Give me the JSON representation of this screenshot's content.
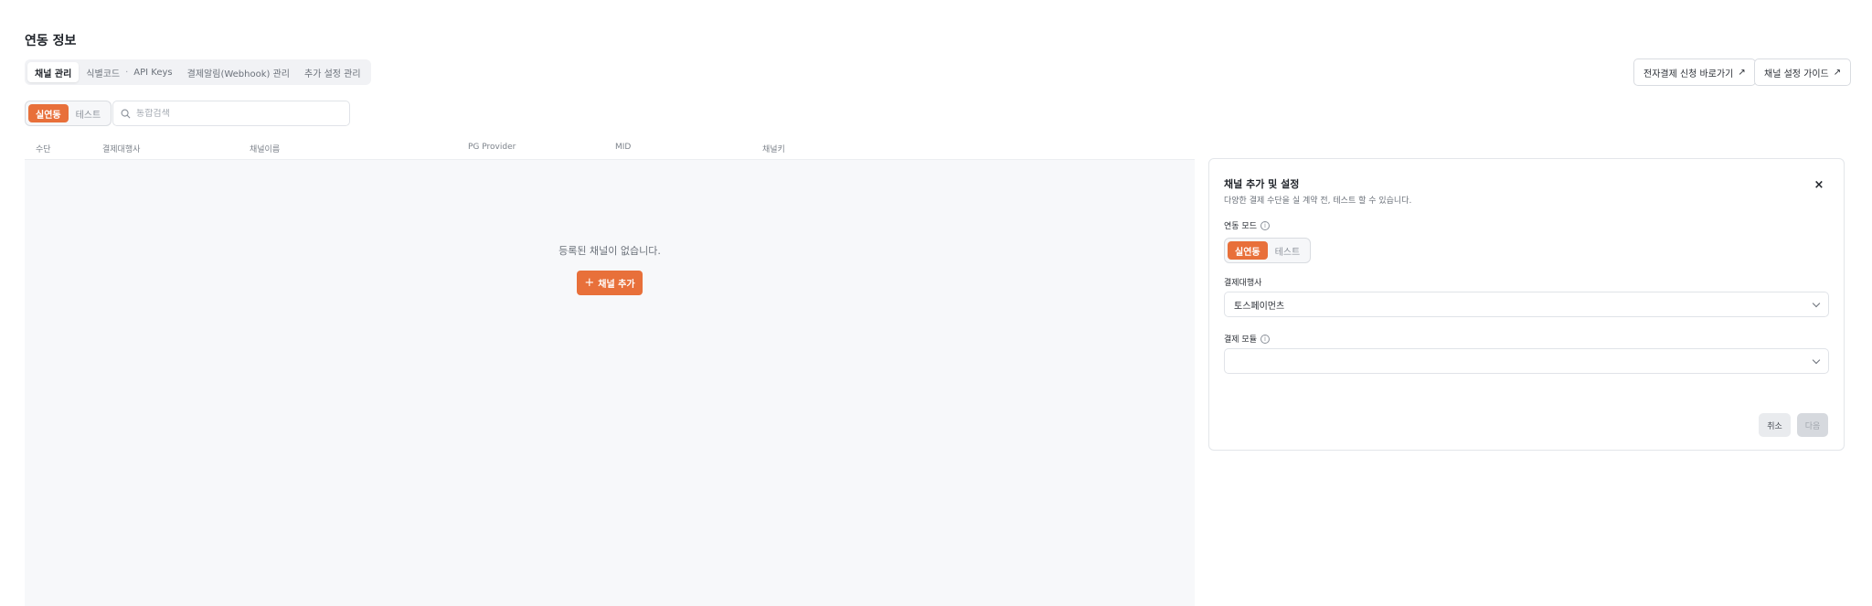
{
  "page_title": "연동 정보",
  "tabs": [
    {
      "label": "채널 관리"
    },
    {
      "label": "식별코드",
      "label2": "API Keys"
    },
    {
      "label": "결제알림(Webhook) 관리"
    },
    {
      "label": "추가 설정 관리"
    }
  ],
  "tab_separator": "·",
  "header_buttons": {
    "apply_label": "전자결제 신청 바로가기",
    "guide_label": "채널 설정 가이드",
    "ext_glyph": "↗"
  },
  "mode_toggle": {
    "live": "실연동",
    "test": "테스트",
    "selected": "실연동"
  },
  "search": {
    "placeholder": "통합검색",
    "value": ""
  },
  "columns": [
    "수단",
    "결제대행사",
    "채널이름",
    "PG Provider",
    "MID",
    "채널키"
  ],
  "empty_state": {
    "message": "등록된 채널이 없습니다.",
    "add_button": "채널 추가",
    "plus_glyph": "+"
  },
  "panel": {
    "title": "채널 추가 및 설정",
    "subtitle": "다양한 결제 수단을 실 계약 전, 테스트 할 수 있습니다.",
    "close_glyph": "×",
    "mode_label": "연동 모드",
    "mode_live": "실연동",
    "mode_test": "테스트",
    "pg_label": "결제대행사",
    "pg_value": "토스페이먼츠",
    "module_label": "결제 모듈",
    "module_value": "",
    "info_glyph": "i",
    "cancel_label": "취소",
    "next_label": "다음"
  },
  "colors": {
    "accent": "#e8703a",
    "empty_bg": "#f7f8fa"
  }
}
